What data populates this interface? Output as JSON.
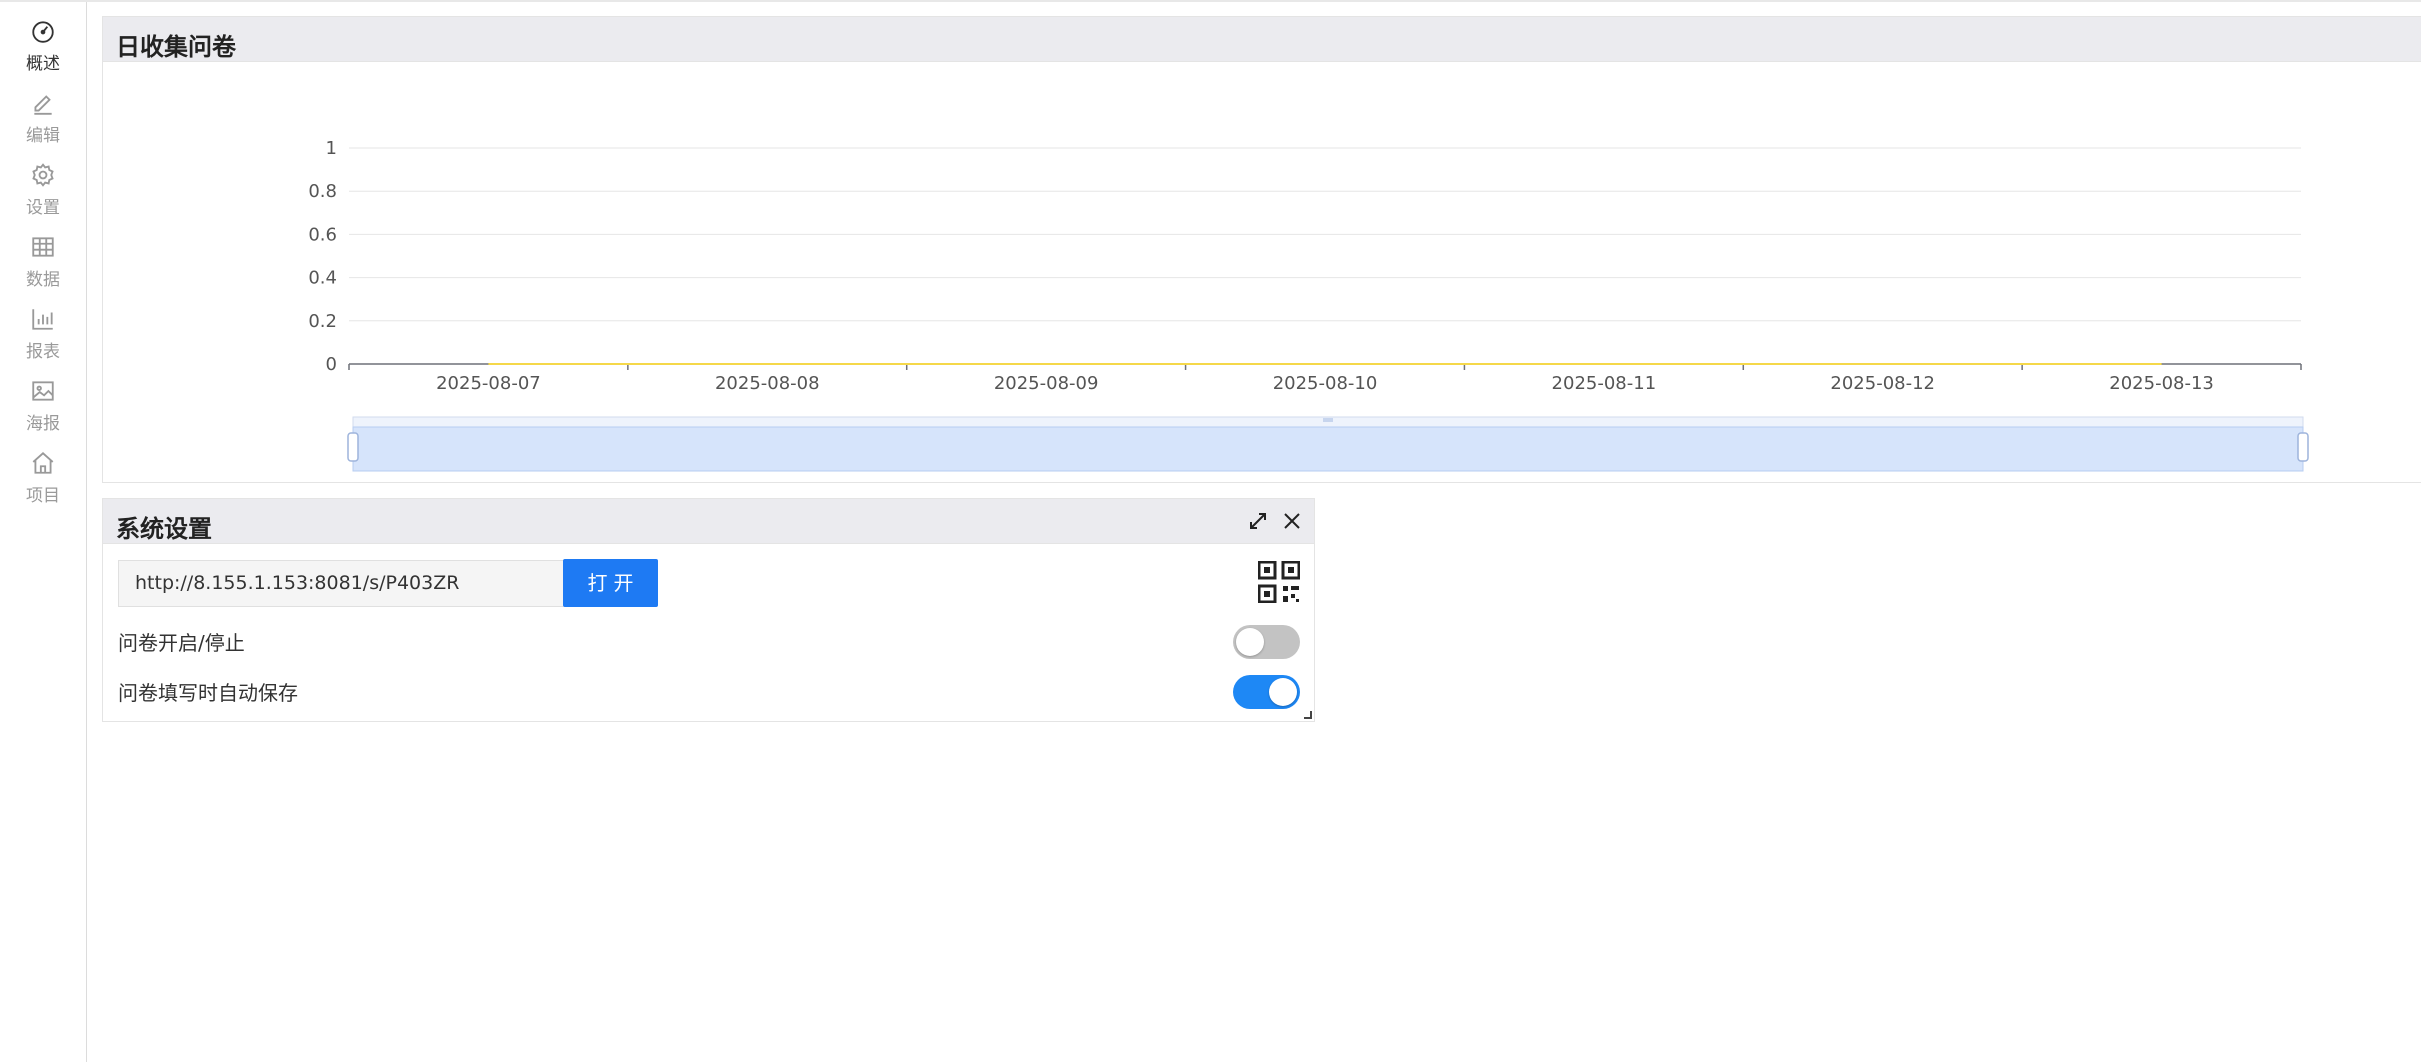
{
  "sidebar": {
    "items": [
      {
        "label": "概述",
        "icon": "dashboard-icon",
        "active": true
      },
      {
        "label": "编辑",
        "icon": "pencil-icon",
        "active": false
      },
      {
        "label": "设置",
        "icon": "gear-icon",
        "active": false
      },
      {
        "label": "数据",
        "icon": "table-icon",
        "active": false
      },
      {
        "label": "报表",
        "icon": "bar-chart-icon",
        "active": false
      },
      {
        "label": "海报",
        "icon": "image-icon",
        "active": false
      },
      {
        "label": "项目",
        "icon": "home-icon",
        "active": false
      }
    ]
  },
  "chart_panel": {
    "title": "日收集问卷"
  },
  "chart_data": {
    "type": "line",
    "x": [
      "2025-08-07",
      "2025-08-08",
      "2025-08-09",
      "2025-08-10",
      "2025-08-11",
      "2025-08-12",
      "2025-08-13"
    ],
    "y_ticks": [
      "0",
      "0.2",
      "0.4",
      "0.6",
      "0.8",
      "1"
    ],
    "series": [
      {
        "values": [
          0,
          0,
          0,
          0,
          0,
          0,
          0
        ],
        "color": "#f5d84a"
      }
    ],
    "ylim": [
      0,
      1
    ],
    "grid": true,
    "datazoom": {
      "start": 0,
      "end": 100
    }
  },
  "settings_panel": {
    "title": "系统设置",
    "url": "http://8.155.1.153:8081/s/P403ZR",
    "open_label": "打开",
    "toggle_open_label": "问卷开启/停止",
    "toggle_open_value": false,
    "toggle_autosave_label": "问卷填写时自动保存",
    "toggle_autosave_value": true
  },
  "colors": {
    "accent": "#1e7af3",
    "series_line": "#f5d84a",
    "zoom_fill": "#d6e4fb"
  }
}
